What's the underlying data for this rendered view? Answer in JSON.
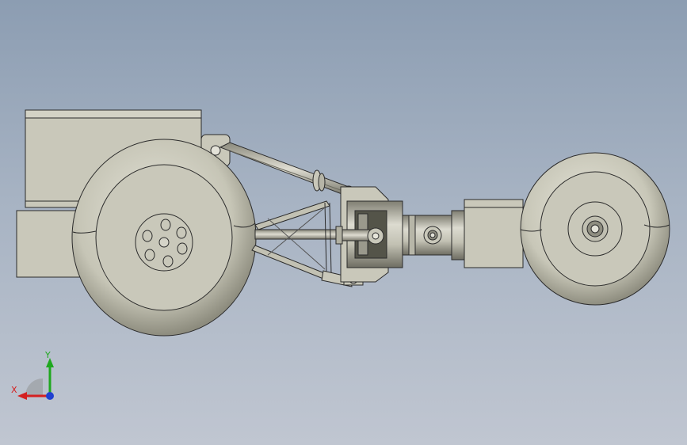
{
  "viewport": {
    "background_top": "#8c9db2",
    "background_bottom": "#c0c6d1"
  },
  "model": {
    "part_fill": "#c9c8ba",
    "part_shadow": "#8f8e80",
    "edge_color": "#2b2b2b",
    "hub_bolt_holes": 6
  },
  "triad": {
    "x_label": "X",
    "y_label": "Y",
    "x_color": "#d42020",
    "y_color": "#1fa81f",
    "z_color": "#2040d0"
  }
}
